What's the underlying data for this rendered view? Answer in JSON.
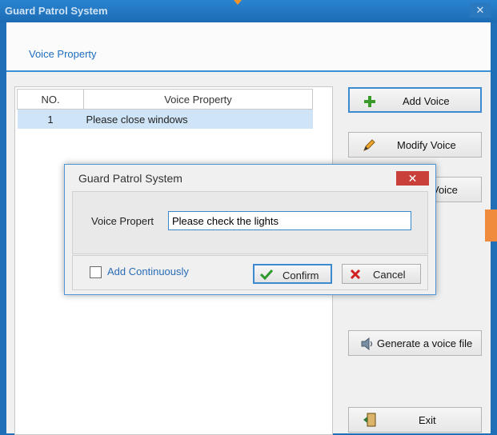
{
  "window": {
    "title": "Guard Patrol System",
    "close_glyph": "✕"
  },
  "header": {
    "label": "Voice Property"
  },
  "table": {
    "headers": [
      "NO.",
      "Voice Property"
    ],
    "rows": [
      {
        "no": "1",
        "prop": "Please close windows"
      }
    ]
  },
  "buttons": {
    "add": "Add Voice",
    "modify": "Modify Voice",
    "delete_partial": "Voice",
    "generate": "Generate a voice file",
    "exit": "Exit"
  },
  "dialog": {
    "title": "Guard Patrol System",
    "close_glyph": "✕",
    "field_label": "Voice Propert",
    "field_value": "Please check the lights",
    "checkbox_label": "Add Continuously",
    "confirm": "Confirm",
    "cancel": "Cancel"
  },
  "icons": {
    "add": "plus-icon",
    "modify": "pencil-icon",
    "generate": "speaker-icon",
    "exit": "exit-door-icon",
    "confirm": "check-icon",
    "cancel": "x-icon"
  },
  "colors": {
    "accent": "#1f6ebf",
    "close_red": "#c9403b",
    "orange": "#f08a3c"
  }
}
